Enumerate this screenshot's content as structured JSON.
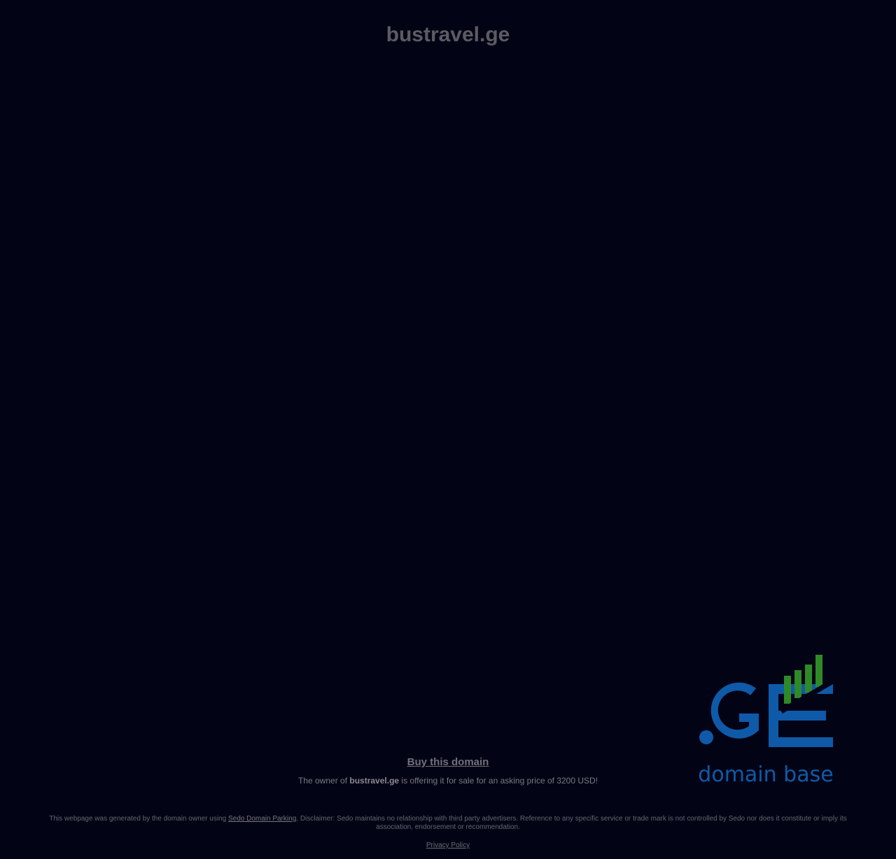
{
  "header": {
    "domain_title": "bustravel.ge"
  },
  "logo": {
    "mark": ".GE",
    "tagline": "domain base",
    "colors": {
      "blue": "#0f5aa8",
      "green": "#2e8a28"
    }
  },
  "sale": {
    "buy_label": "Buy this domain",
    "offer_prefix": "The owner of ",
    "offer_domain": "bustravel.ge",
    "offer_suffix": " is offering it for sale for an asking price of 3200 USD!"
  },
  "footer": {
    "disclaimer_prefix": "This webpage was generated by the domain owner using ",
    "parking_link": "Sedo Domain Parking",
    "disclaimer_suffix": ". Disclaimer: Sedo maintains no relationship with third party advertisers. Reference to any specific service or trade mark is not controlled by Sedo nor does it constitute or imply its association, endorsement or recommendation.",
    "privacy_link": "Privacy Policy"
  },
  "theme": {
    "background": "#020416"
  }
}
